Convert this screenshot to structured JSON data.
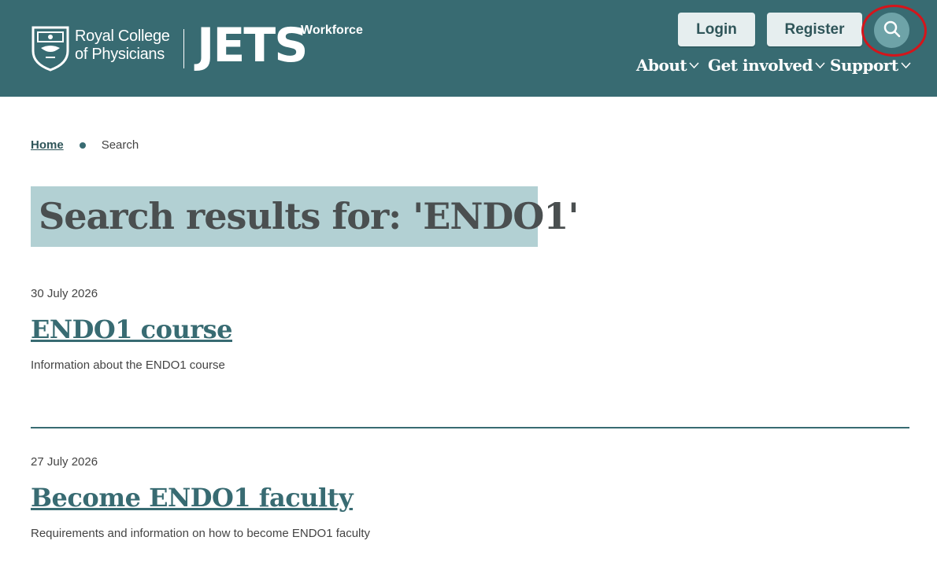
{
  "header": {
    "logo_line1": "Royal College",
    "logo_line2": "of Physicians",
    "product_name": "JETS",
    "product_sub": "Workforce",
    "login_label": "Login",
    "register_label": "Register",
    "search_icon": "search-icon",
    "nav": [
      {
        "label": "About"
      },
      {
        "label": "Get involved"
      },
      {
        "label": "Support"
      }
    ]
  },
  "breadcrumb": {
    "home": "Home",
    "current": "Search"
  },
  "page": {
    "title": "Search results for: 'ENDO1'"
  },
  "results": [
    {
      "date": "30 July 2026",
      "title": "ENDO1 course",
      "description": "Information about the ENDO1 course"
    },
    {
      "date": "27 July 2026",
      "title": "Become ENDO1 faculty",
      "description": "Requirements and information on how to become ENDO1 faculty"
    }
  ],
  "colors": {
    "header_bg": "#386b72",
    "title_highlight": "#b2d0d3",
    "annotation": "#d4151b"
  }
}
